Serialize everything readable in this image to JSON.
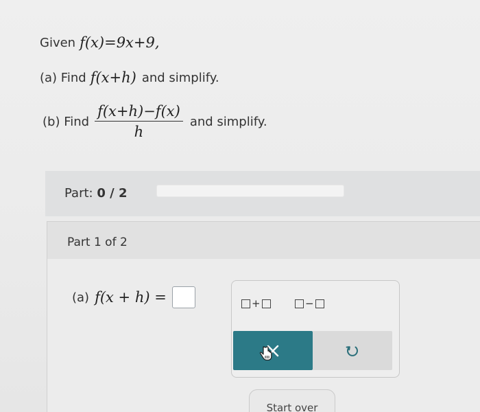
{
  "question": {
    "given_label": "Given",
    "given_expr": "f(x)=9x+9,",
    "part_a_label": "(a) Find",
    "part_a_expr": "f(x+h)",
    "part_a_suffix": "and simplify.",
    "part_b_label": "(b) Find",
    "part_b_numerator": "f(x+h)−f(x)",
    "part_b_denominator": "h",
    "part_b_suffix": "and simplify."
  },
  "progress": {
    "label": "Part:",
    "value_text": "0 / 2",
    "completed": 0,
    "total": 2,
    "fraction": 0,
    "fill_color": "#3b7f8a"
  },
  "part": {
    "title": "Part 1 of 2",
    "answer_label": "(a)",
    "answer_expr": "f(x + h) =",
    "answer_value": ""
  },
  "palette": {
    "plus_operator": "+",
    "minus_operator": "−",
    "clear_icon": "x-icon",
    "undo_icon": "undo-icon",
    "cursor_icon": "hand-cursor-icon",
    "clear_color": "#2c7a87"
  },
  "footer": {
    "start_over_label": "Start over"
  }
}
